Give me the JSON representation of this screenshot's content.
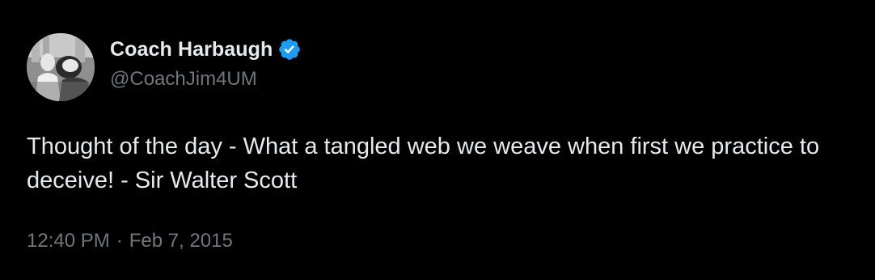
{
  "author": {
    "display_name": "Coach Harbaugh",
    "handle": "@CoachJim4UM",
    "verified_icon": "verified-badge-icon",
    "verified_color": "#1d9bf0"
  },
  "tweet": {
    "text": "Thought of the day - What a tangled web we weave when first we practice to deceive! - Sir Walter Scott",
    "time": "12:40 PM",
    "separator": "·",
    "date": "Feb 7, 2015"
  },
  "colors": {
    "background": "#000000",
    "primary_text": "#e7e9ea",
    "secondary_text": "#71767b"
  }
}
